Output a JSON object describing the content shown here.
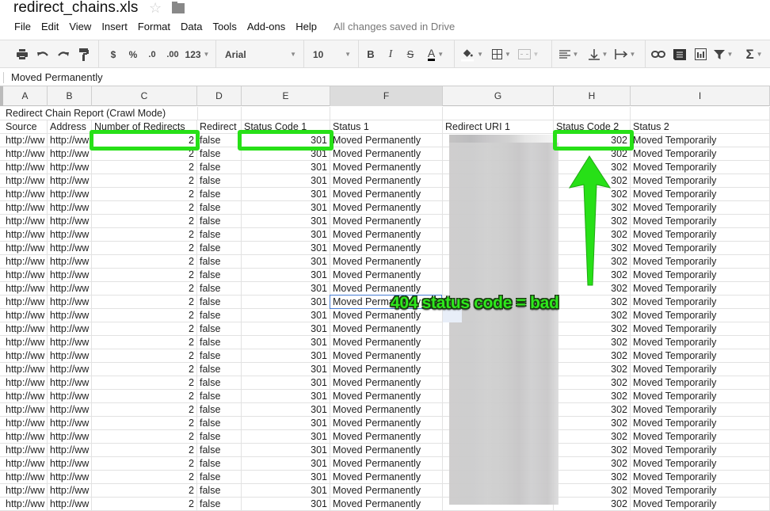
{
  "app": {
    "doc_title": "redirect_chains.xls",
    "star_icon": "star-outline-icon",
    "folder_icon": "folder-icon"
  },
  "menu": {
    "items": [
      "File",
      "Edit",
      "View",
      "Insert",
      "Format",
      "Data",
      "Tools",
      "Add-ons",
      "Help"
    ],
    "save_status": "All changes saved in Drive"
  },
  "toolbar": {
    "print": "⎙",
    "currency": "$",
    "percent": "%",
    "decrease_decimals": ".0",
    "increase_decimals": ".00",
    "more_formats": "123",
    "font": "Arial",
    "font_size": "10",
    "bold": "B",
    "italic": "I",
    "strikethrough": "S",
    "text_color": "A",
    "sum": "Σ"
  },
  "formula_bar": {
    "value": "Moved Permanently"
  },
  "columns": [
    "A",
    "B",
    "C",
    "D",
    "E",
    "F",
    "G",
    "H",
    "I"
  ],
  "active_column": "F",
  "sheet": {
    "report_title": "Redirect Chain Report (Crawl Mode)",
    "headers": [
      "Source",
      "Address",
      "Number of Redirects",
      "Redirect",
      "Status Code 1",
      "Status 1",
      "Redirect URI 1",
      "Status Code 2",
      "Status 2"
    ],
    "row_template": {
      "source": "http://ww",
      "address": "http://ww",
      "num_redirects": "2",
      "redirect_loop": "false",
      "status_code_1": "301",
      "status_1": "Moved Permanently",
      "redirect_uri_1": "",
      "status_code_2": "302",
      "status_2": "Moved Temporarily"
    },
    "visible_data_rows": 28,
    "redirect_uri_obscured": true
  },
  "annotation": {
    "text": "404 status code = bad",
    "color": "#27e017"
  }
}
